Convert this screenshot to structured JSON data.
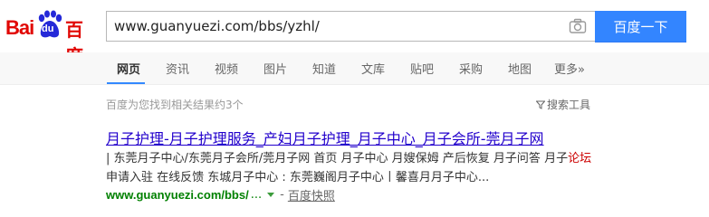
{
  "logo": {
    "part1": "Bai",
    "part2": "du",
    "part3": "百度"
  },
  "search": {
    "query": "www.guanyuezi.com/bbs/yzhl/",
    "button_label": "百度一下"
  },
  "nav": {
    "tabs": [
      "网页",
      "资讯",
      "视频",
      "图片",
      "知道",
      "文库",
      "贴吧",
      "采购",
      "地图",
      "更多»"
    ],
    "active_index": 0
  },
  "results_info": {
    "count_text": "百度为您找到相关结果约3个",
    "tools_label": "搜索工具"
  },
  "result": {
    "title": "月子护理-月子护理服务_产妇月子护理_月子中心_月子会所-莞月子网",
    "snippet_line1": "| 东莞月子中心/东莞月子会所/莞月子网 首页 月子中心 月嫂保姆 产后恢复 月子问答 月子",
    "snippet_line1_highlight": "论坛",
    "snippet_line2": "申请入驻 在线反馈 东城月子中心 : 东莞巍阁月子中心丨馨喜月月子中心...",
    "url": "www.guanyuezi.com/bbs/",
    "url_ellipsis": "...",
    "dash": "-",
    "snapshot_label": "百度快照"
  },
  "colors": {
    "brand_red": "#e10602",
    "brand_blue": "#3385ff",
    "link": "#2200cc",
    "url_green": "#008000"
  },
  "icons": {
    "camera": "camera-icon",
    "funnel": "funnel-icon",
    "paw": "baidu-paw-icon"
  }
}
